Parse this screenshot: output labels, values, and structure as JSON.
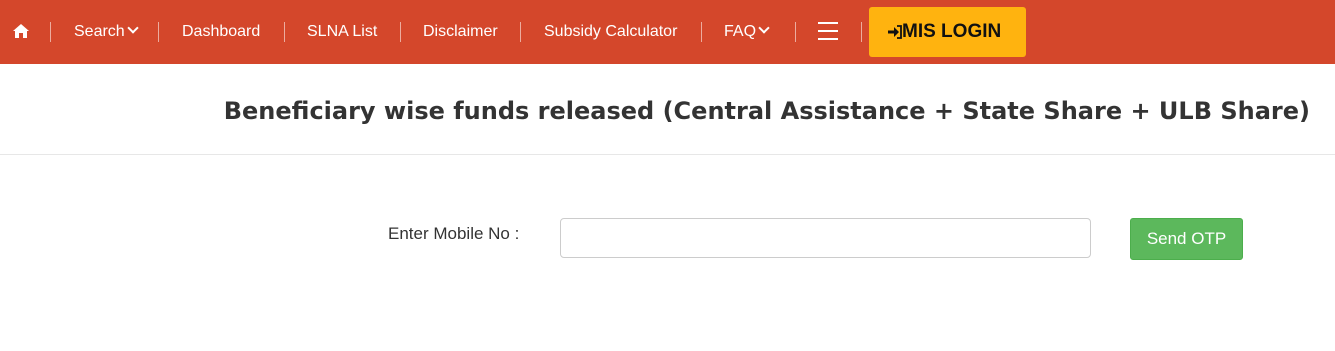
{
  "nav": {
    "home_icon": "home-icon",
    "items": [
      {
        "label": "Search",
        "dropdown": true
      },
      {
        "label": "Dashboard"
      },
      {
        "label": "SLNA List"
      },
      {
        "label": "Disclaimer"
      },
      {
        "label": "Subsidy Calculator"
      },
      {
        "label": "FAQ",
        "dropdown": true
      }
    ],
    "menu_icon": "hamburger-menu-icon",
    "login": {
      "label": "MIS LOGIN",
      "icon": "sign-in-icon"
    },
    "colors": {
      "bar": "#d4472b",
      "login_bg": "#ffb30f"
    }
  },
  "page": {
    "title": "Beneficiary wise funds released (Central Assistance + State Share + ULB Share)"
  },
  "form": {
    "mobile_label": "Enter Mobile No :",
    "mobile_value": "",
    "send_otp_label": "Send OTP",
    "colors": {
      "send_otp_bg": "#5cb85c"
    }
  }
}
